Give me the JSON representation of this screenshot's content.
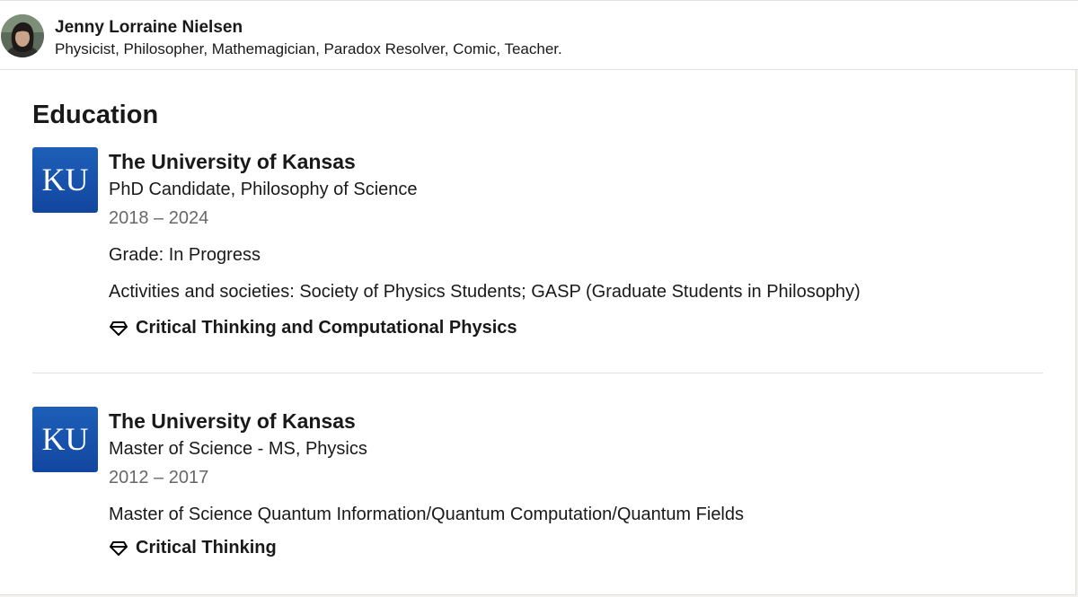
{
  "profile": {
    "name": "Jenny Lorraine Nielsen",
    "headline": "Physicist, Philosopher, Mathemagician, Paradox Resolver, Comic, Teacher."
  },
  "education": {
    "title": "Education",
    "entries": [
      {
        "logo_text": "KU",
        "school": "The University of Kansas",
        "degree": "PhD Candidate, Philosophy of Science",
        "dates": "2018 – 2024",
        "grade": "Grade: In Progress",
        "activities": "Activities and societies: Society of Physics Students; GASP (Graduate Students in Philosophy)",
        "skill": "Critical Thinking and Computational Physics"
      },
      {
        "logo_text": "KU",
        "school": "The University of Kansas",
        "degree": "Master of Science - MS, Physics",
        "dates": "2012 – 2017",
        "description": "Master of Science Quantum Information/Quantum Computation/Quantum Fields",
        "skill": "Critical Thinking"
      }
    ]
  },
  "colors": {
    "logo_blue": "#1d5fb8",
    "text_primary": "#000000e6",
    "text_secondary": "#00000099",
    "divider": "#e0dfdc"
  },
  "icons": {
    "skill": "diamond-icon"
  }
}
